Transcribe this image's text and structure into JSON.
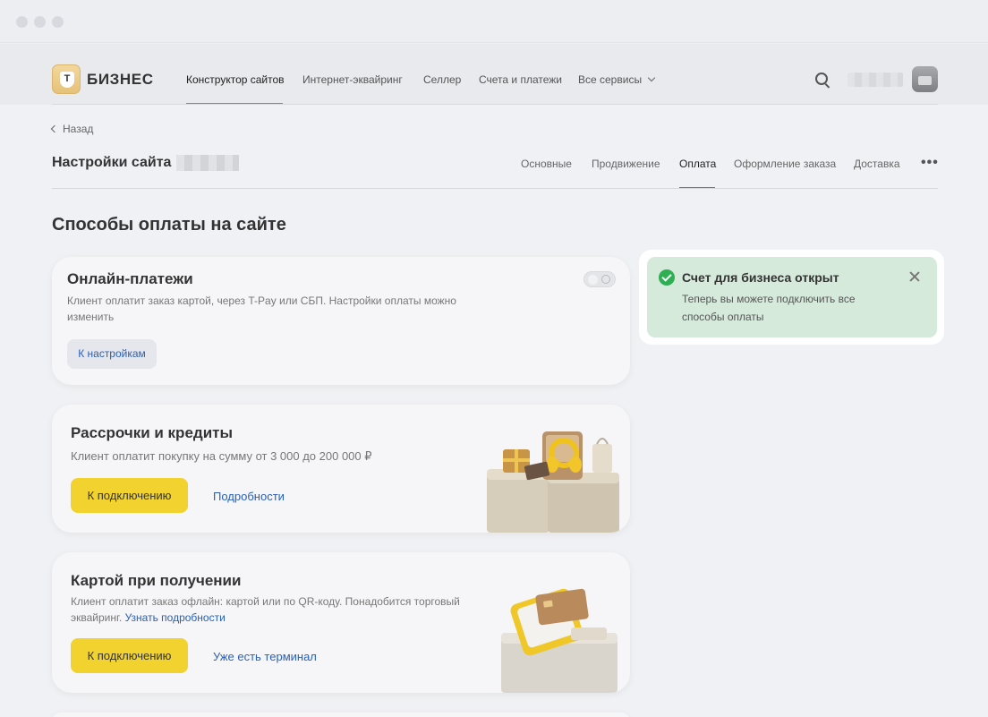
{
  "header": {
    "logo_letter": "Т",
    "logo_text": "БИЗНЕС",
    "nav": [
      {
        "label": "Конструктор сайтов"
      },
      {
        "label": "Интернет-эквайринг"
      },
      {
        "label": "Селлер"
      },
      {
        "label": "Счета и платежи"
      },
      {
        "label": "Все сервисы"
      }
    ]
  },
  "back_label": "Назад",
  "page_title": "Настройки сайта",
  "tabs": [
    {
      "label": "Основные"
    },
    {
      "label": "Продвижение"
    },
    {
      "label": "Оплата"
    },
    {
      "label": "Оформление заказа"
    },
    {
      "label": "Доставка"
    }
  ],
  "more_label": "•••",
  "section_title": "Способы оплаты на сайте",
  "cards": {
    "online": {
      "title": "Онлайн-платежи",
      "description": "Клиент оплатит заказ картой, через T-Pay или СБП. Настройки оплаты можно изменить",
      "button": "К настройкам",
      "toggle_on": false
    },
    "installments": {
      "title": "Рассрочки и кредиты",
      "description": "Клиент оплатит покупку на сумму от 3 000 до 200 000 ₽",
      "button": "К подключению",
      "link": "Подробности"
    },
    "card_on_delivery": {
      "title": "Картой при получении",
      "description": "Клиент оплатит заказ офлайн: картой или по QR-коду. Понадобится торговый эквайринг.",
      "description_link": "Узнать подробности",
      "button": "К подключению",
      "link": "Уже есть терминал"
    }
  },
  "toast": {
    "title": "Счет для бизнеса открыт",
    "text": "Теперь вы можете подключить все способы оплаты"
  },
  "colors": {
    "accent_yellow": "#f2d22f",
    "link_blue": "#2a60b8",
    "toast_bg": "#d5eadb",
    "success_green": "#2fae53"
  }
}
